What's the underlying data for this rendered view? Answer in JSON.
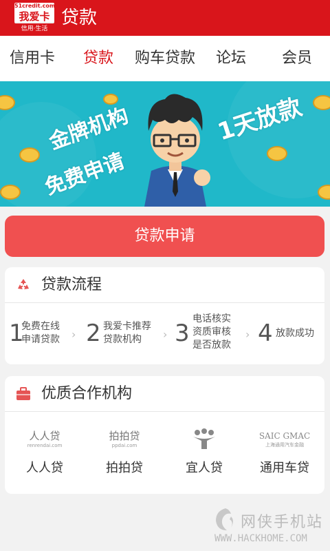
{
  "header": {
    "logo_top": "51credit.com",
    "logo_main": "我爱卡",
    "logo_sub": "信用·生活",
    "title": "贷款"
  },
  "tabs": [
    {
      "label": "信用卡",
      "active": false
    },
    {
      "label": "贷款",
      "active": true
    },
    {
      "label": "购车贷款",
      "active": false
    },
    {
      "label": "论坛",
      "active": false
    },
    {
      "label": "会员",
      "active": false
    }
  ],
  "banner": {
    "text_left_1": "金牌机构",
    "text_left_2": "免费申请",
    "text_right": "1天放款"
  },
  "apply_button": "贷款申请",
  "process": {
    "title": "贷款流程",
    "steps": [
      {
        "num": "1",
        "text": "免费在线\n申请贷款"
      },
      {
        "num": "2",
        "text": "我爱卡推荐\n贷款机构"
      },
      {
        "num": "3",
        "text": "电话核实\n资质审核\n是否放款"
      },
      {
        "num": "4",
        "text": "放款成功"
      }
    ]
  },
  "partners": {
    "title": "优质合作机构",
    "items": [
      {
        "logo": "人人贷",
        "logo_sub": "renrendai.com",
        "name": "人人贷"
      },
      {
        "logo": "拍拍贷",
        "logo_sub": "ppdai.com",
        "name": "拍拍贷"
      },
      {
        "logo": "",
        "logo_sub": "",
        "name": "宜人贷"
      },
      {
        "logo": "SAIC GMAC",
        "logo_sub": "上海通用汽车金融",
        "name": "通用车贷"
      }
    ]
  },
  "watermark": {
    "text": "网侠手机站",
    "url": "WWW.HACKHOME.COM"
  },
  "colors": {
    "brand_red": "#d9151b",
    "apply_button": "#f05050",
    "banner_teal": "#20b8c9"
  }
}
